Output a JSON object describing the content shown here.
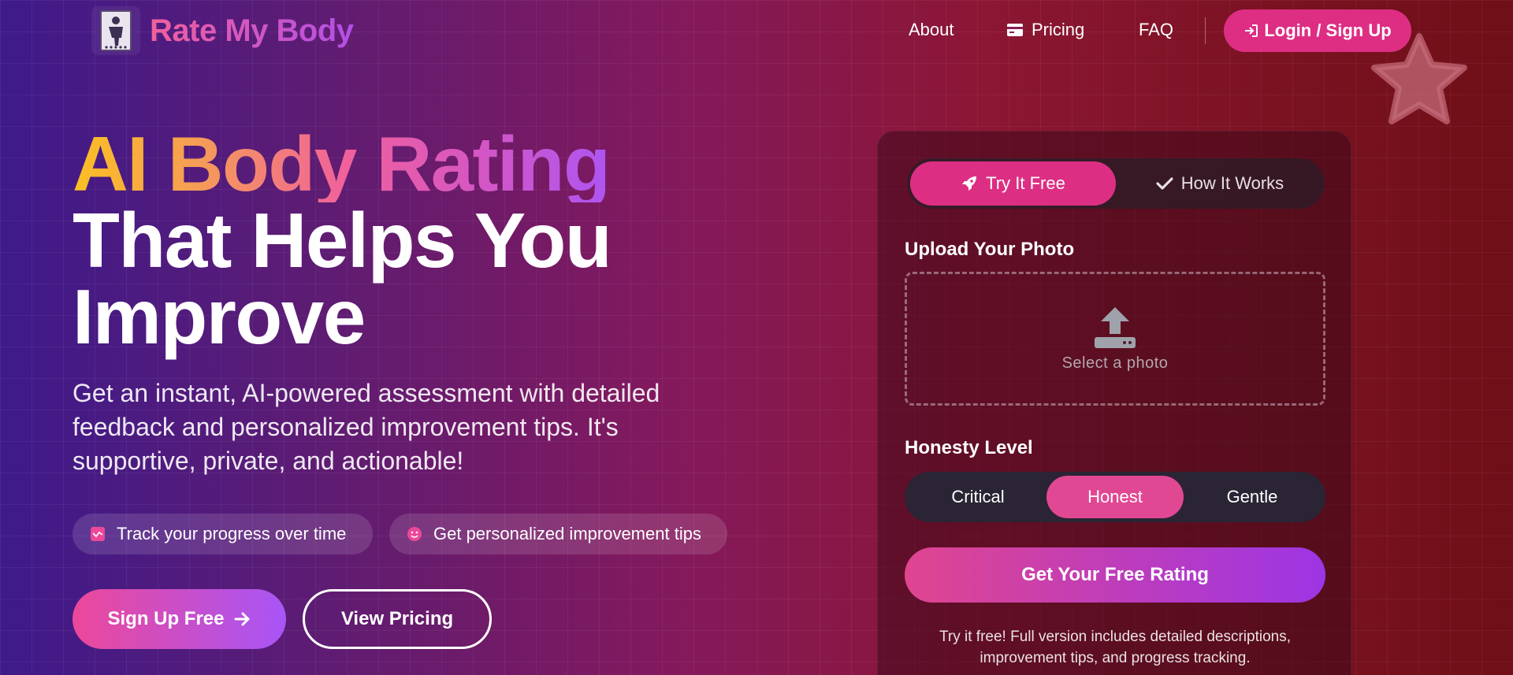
{
  "nav": {
    "brand": "Rate My Body",
    "links": {
      "about": "About",
      "pricing": "Pricing",
      "faq": "FAQ"
    },
    "login": "Login / Sign Up"
  },
  "hero": {
    "title_line1": "AI Body Rating",
    "title_line2": "That Helps You",
    "title_line3": "Improve",
    "subtitle": "Get an instant, AI-powered assessment with detailed feedback and personalized improvement tips. It's supportive, private, and actionable!",
    "pills": [
      {
        "label": "Track your progress over time",
        "icon": "chart-icon"
      },
      {
        "label": "Get personalized improvement tips",
        "icon": "smile-icon"
      }
    ],
    "signup_button": "Sign Up Free",
    "pricing_button": "View Pricing"
  },
  "card": {
    "tabs": {
      "try": "Try It Free",
      "how": "How It Works",
      "active": "try"
    },
    "upload_label": "Upload Your Photo",
    "upload_text": "Select a photo",
    "honesty_label": "Honesty Level",
    "honesty_options": [
      "Critical",
      "Honest",
      "Gentle"
    ],
    "honesty_selected": "Honest",
    "cta": "Get Your Free Rating",
    "note": "Try it free! Full version includes detailed descriptions, improvement tips, and progress tracking."
  },
  "colors": {
    "accent_pink": "#dd2e84",
    "accent_purple": "#a855f7",
    "title_gradient_start": "#fbbf24"
  }
}
